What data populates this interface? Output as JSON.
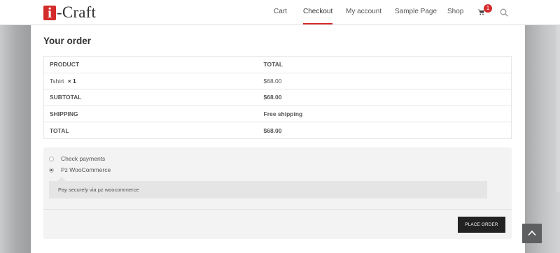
{
  "header": {
    "logo_letter": "i",
    "logo_text": "-Craft",
    "nav": [
      {
        "label": "Cart"
      },
      {
        "label": "Checkout"
      },
      {
        "label": "My account"
      },
      {
        "label": "Sample Page"
      },
      {
        "label": "Shop"
      }
    ],
    "active_nav": "Checkout",
    "cart_count": "1",
    "accent_color": "#d42b2b"
  },
  "order": {
    "heading": "Your order",
    "col_product": "PRODUCT",
    "col_total": "TOTAL",
    "item_name": "Tshirt",
    "item_qty": "× 1",
    "item_total": "$68.00",
    "subtotal_label": "SUBTOTAL",
    "subtotal_value": "$68.00",
    "shipping_label": "SHIPPING",
    "shipping_value": "Free shipping",
    "total_label": "TOTAL",
    "total_value": "$68.00"
  },
  "payment": {
    "methods": [
      {
        "label": "Check payments",
        "selected": false
      },
      {
        "label": "Pz WooCommerce",
        "selected": true
      }
    ],
    "description": "Pay securely via pz woocommerce",
    "place_order_label": "PLACE ORDER"
  },
  "icons": {
    "cart": "cart-icon",
    "search": "search-icon",
    "scroll_top": "chevron-up-icon"
  }
}
